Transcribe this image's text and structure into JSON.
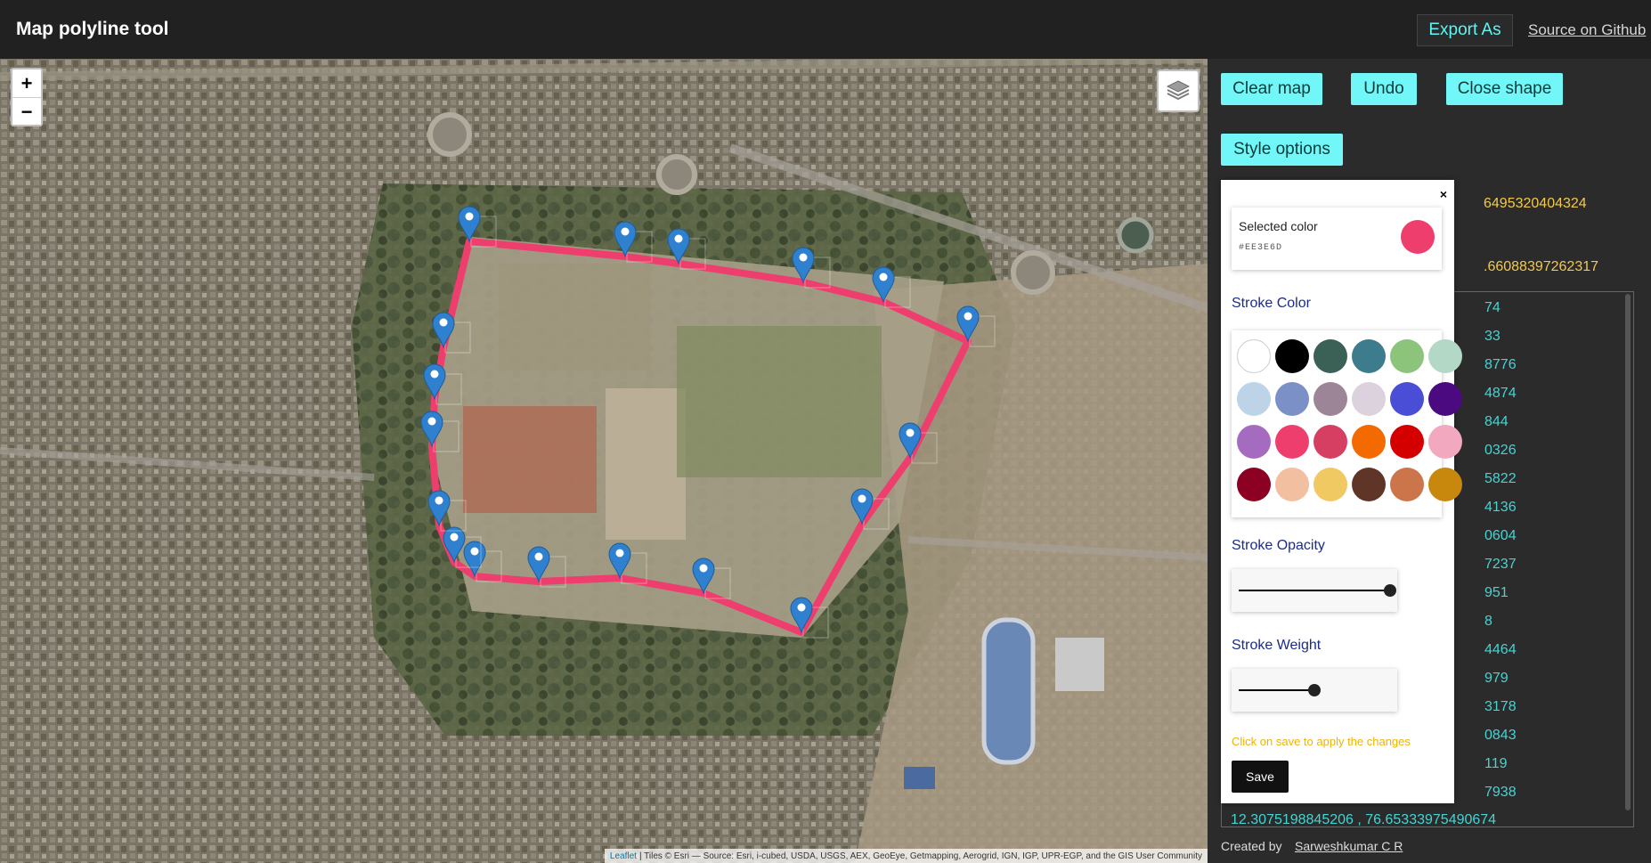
{
  "header": {
    "title": "Map polyline tool",
    "export_label": "Export As",
    "source_link": "Source on Github"
  },
  "map": {
    "zoom_in": "+",
    "zoom_out": "−",
    "layers_icon": "layers-icon",
    "attribution_leaflet": "Leaflet",
    "attribution_text": "| Tiles © Esri — Source: Esri, i-cubed, USDA, USGS, AEX, GeoEye, Getmapping, Aerogrid, IGN, IGP, UPR-EGP, and the GIS User Community",
    "polyline_color": "#EE3E6D",
    "marker_color": "#2f80cf",
    "marker_icon": "map-pin-icon"
  },
  "controls": {
    "clear_label": "Clear map",
    "undo_label": "Undo",
    "close_shape_label": "Close shape",
    "style_options_label": "Style options"
  },
  "coords": {
    "top_lines": [
      "6495320404324",
      ".66088397262317"
    ],
    "lines": [
      "74",
      "33",
      "8776",
      "4874",
      "844",
      "0326",
      "5822",
      "4136",
      "0604",
      "7237",
      "951",
      "8",
      "4464",
      "979",
      "3178",
      "0843",
      "119",
      "7938",
      "12.3075198845206 , 76.65333975490674"
    ]
  },
  "footer": {
    "created_by": "Created by",
    "author": "Sarweshkumar C R"
  },
  "style_popup": {
    "close_label": "×",
    "selected_color_label": "Selected color",
    "selected_color_hex": "#EE3E6D",
    "stroke_color_label": "Stroke Color",
    "swatches": [
      "#ffffff",
      "#000000",
      "#3b6156",
      "#3d7c8c",
      "#8dc47c",
      "#b3d8c6",
      "#bdd4e8",
      "#7a90c6",
      "#9c8596",
      "#dcd2dd",
      "#4a4ed6",
      "#4b0a7f",
      "#a56bc0",
      "#ee3e6d",
      "#d63e62",
      "#f26a00",
      "#d40000",
      "#f2a8bf",
      "#8b0023",
      "#f2bfa0",
      "#f1c962",
      "#5f3528",
      "#cc754a",
      "#c8870d"
    ],
    "stroke_opacity_label": "Stroke Opacity",
    "stroke_opacity_value": 1.0,
    "stroke_weight_label": "Stroke Weight",
    "stroke_weight_value": 0.5,
    "save_hint": "Click on save to apply the changes",
    "save_label": "Save"
  }
}
